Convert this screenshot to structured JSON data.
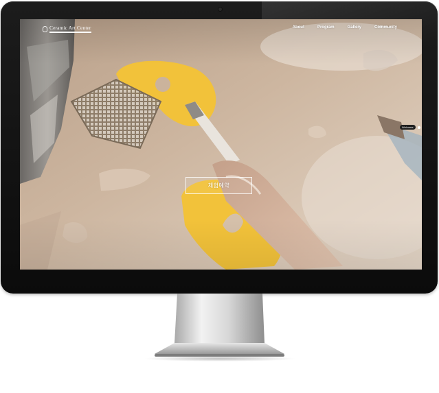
{
  "site": {
    "logo_text": "Ceramic Art Center",
    "nav": [
      {
        "label": "About"
      },
      {
        "label": "Program"
      },
      {
        "label": "Gallery"
      },
      {
        "label": "Community"
      }
    ],
    "hero_button_label": "체험예약",
    "welcome_badge": "Welcome"
  },
  "icons": {
    "logo": "pottery-vase-icon",
    "camera": "webcam-dot",
    "welcome_indicator": "dot-icon"
  },
  "colors": {
    "bezel": "#111111",
    "screen_background": "#c9b29d",
    "accent_yellow": "#f2c23a",
    "nav_text": "#ffffff"
  }
}
